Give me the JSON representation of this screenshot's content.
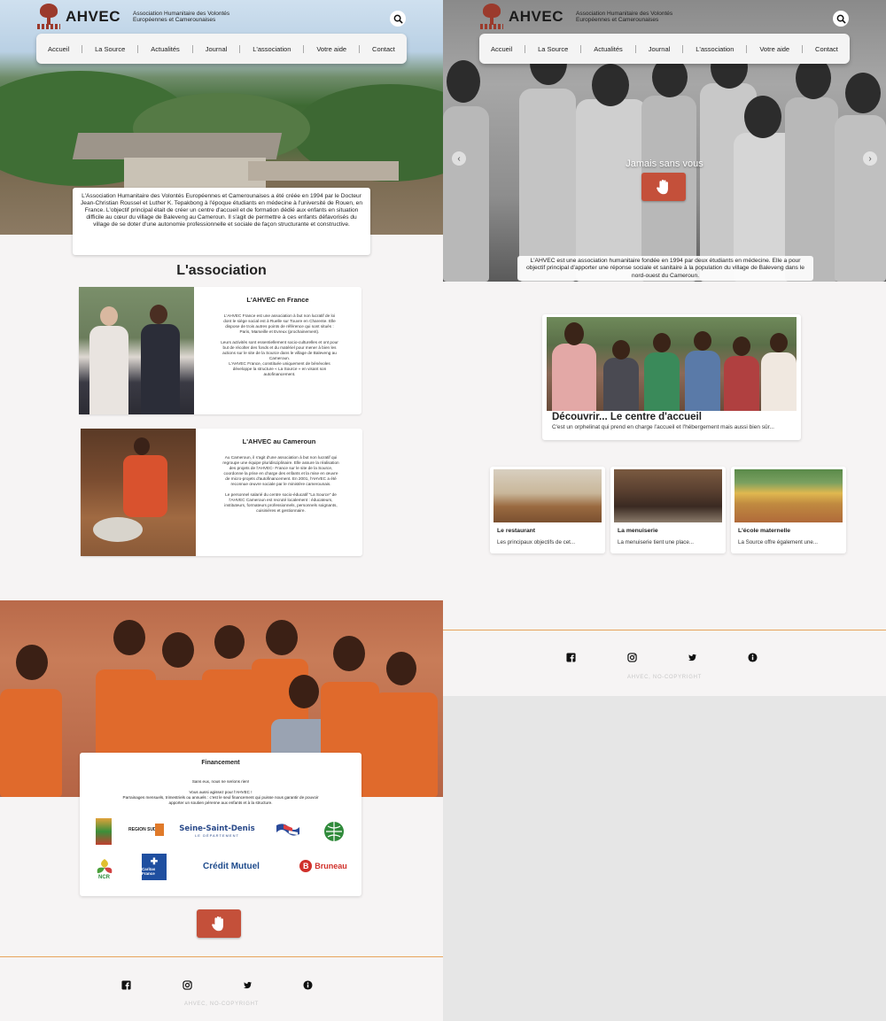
{
  "brand": {
    "name": "AHVEC",
    "subtitle_line1": "Association Humanitaire des Volontés",
    "subtitle_line2": "Européennes et Camerounaises"
  },
  "nav": {
    "items": [
      "Accueil",
      "La Source",
      "Actualités",
      "Journal",
      "L'association",
      "Votre aide",
      "Contact"
    ]
  },
  "left": {
    "intro": "L'Association Humanitaire des Volontés Européennes et Camerounaises a été créée en 1994 par le Docteur Jean-Christian Roussel et Luther K. Tepakbong à l'époque étudiants en médecine à l'université de Rouen, en France. L'objectif principal était de créer un centre d'accueil et de formation dédié aux enfants en situation difficile au cœur du village de Baleveng au Cameroun. Il s'agit de permettre à ces enfants défavorisés du village de se doter d'une autonomie professionnelle et sociale de façon structurante et constructive.",
    "section_title": "L'association",
    "card_france": {
      "title": "L'AHVEC en France",
      "body": "L'AHVEC France est une association à but non lucratif de loi dont le siège social est à Ruelle sur Touvre en Charente. Elle dispose de trois autres points de référence qui sont situés : Paris, Marseille et Evreux (prochainement).\n\nLeurs activités sont essentiellement socio-culturelles et ont pour but de récolter des fonds et du matériel pour mener à bien les actions sur le site de la Source dans le village de Baleveng au Cameroun.\nL'AHVEC France, constituée uniquement de bénévoles développe la structure « La Source » en visant son autofinancement."
    },
    "card_cameroun": {
      "title": "L'AHVEC au Cameroun",
      "body": "Au Cameroun, il s'agit d'une association à but non lucratif qui regroupe une équipe pluridisciplinaire. Elle assure la réalisation des projets de l'AHVEC- France sur le site de la Source, coordonne la prise en charge des enfants et la mise en œuvre de micro-projets d'autofinancement. En 2001, l'AHVEC a été reconnue œuvre sociale par le ministère camerounais.\n\nLe personnel salarié du centre socio-éducatif \"La Source\" de l'AHVEC Cameroun est recruté localement : éducateurs, instituteurs, formateurs professionnels, personnels soignants, cuisinières et gestionnaire."
    },
    "financement": {
      "title": "Financement",
      "body": "Sans eux, nous ne serions rien!\n\nVous aussi agissez pour l'AHVEC !\nParrainages mensuels, trimestriels ou annuels : c'est le seul financement qui puisse nous garantir de pouvoir apporter un soutien pérenne aux enfants et à la structure.",
      "sponsors": [
        "REGION SUD",
        "Seine-Saint-Denis",
        "LE DÉPARTEMENT",
        "Crédit Mutuel",
        "Bruneau",
        "Caritas France",
        "NCR"
      ]
    },
    "copyright": "AHVEC, NO-COPYRIGHT"
  },
  "right": {
    "slide_title": "Jamais sans vous",
    "caption": "L'AHVEC est une association humanitaire fondée en 1994 par deux étudiants en médecine. Elle a pour objectif principal d'apporter une réponse sociale et sanitaire à la population du village de Baleveng dans le nord-ouest du Cameroun.",
    "discover": {
      "title": "Découvrir... Le centre d'accueil",
      "text": "C'est un orphelinat qui prend en charge l'accueil et l'hébergement mais aussi bien sûr..."
    },
    "cards": [
      {
        "title": "Le restaurant",
        "text": "Les principaux objectifs de cet..."
      },
      {
        "title": "La menuiserie",
        "text": "La menuiserie tient une place..."
      },
      {
        "title": "L'école maternelle",
        "text": "La Source offre également une..."
      }
    ],
    "copyright": "AHVEC, NO-COPYRIGHT"
  },
  "icons": {
    "search": "search-icon",
    "hand": "hand-icon",
    "facebook": "facebook-icon",
    "instagram": "instagram-icon",
    "twitter": "twitter-icon",
    "info": "info-icon",
    "prev": "chevron-left-icon",
    "next": "chevron-right-icon"
  },
  "colors": {
    "accent": "#c4503a",
    "brand": "#9b3a2c",
    "footer_line": "#e7a45c"
  }
}
